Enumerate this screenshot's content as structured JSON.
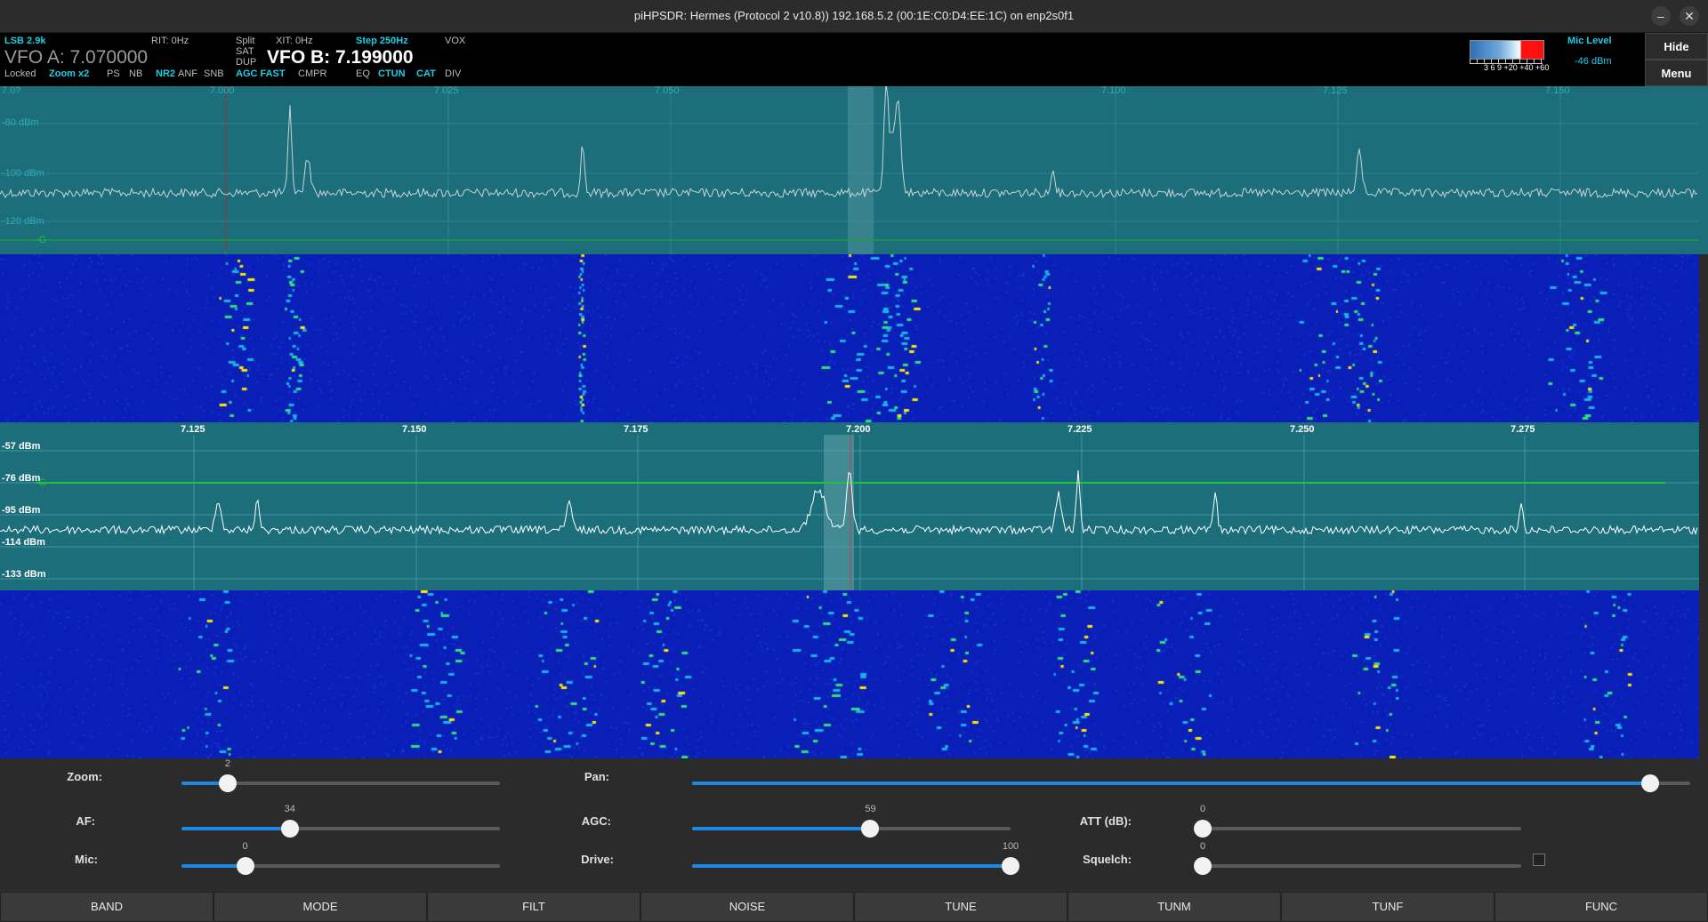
{
  "window": {
    "title": "piHPSDR: Hermes (Protocol 2 v10.8)) 192.168.5.2 (00:1E:C0:D4:EE:1C) on enp2s0f1",
    "minimize": "–",
    "close": "✕"
  },
  "vfo_bar": {
    "mode": "LSB 2.9k",
    "vfo_a": "VFO A: 7.070000",
    "rit": "RIT: 0Hz",
    "split": "Split",
    "sat": "SAT",
    "dup": "DUP",
    "xit": "XIT: 0Hz",
    "step": "Step 250Hz",
    "vox": "VOX",
    "vfo_b": "VFO B: 7.199000",
    "locked": "Locked",
    "zoom": "Zoom x2",
    "ps": "PS",
    "nb": "NB",
    "nr2": "NR2",
    "anf": "ANF",
    "snb": "SNB",
    "agc": "AGC FAST",
    "cmpr": "CMPR",
    "eq": "EQ",
    "ctun": "CTUN",
    "cat": "CAT",
    "div": "DIV",
    "mic_level": "Mic Level",
    "mic_dbm": "-46 dBm",
    "meter_scale": [
      "3",
      "6",
      "9",
      "+20",
      "+40",
      "+60"
    ]
  },
  "side_buttons": {
    "hide": "Hide",
    "menu": "Menu"
  },
  "panadapter_a": {
    "freq_labels": [
      "7.0?",
      "7.000",
      "7.025",
      "7.050",
      "7.100",
      "7.125",
      "7.150"
    ],
    "dbm_labels": [
      "-80 dBm",
      "-100 dBm",
      "-120 dBm"
    ],
    "agc_marker": "-G"
  },
  "panadapter_b": {
    "freq_labels": [
      "7.125",
      "7.150",
      "7.175",
      "7.200",
      "7.225",
      "7.250",
      "7.275"
    ],
    "dbm_labels": [
      "-57 dBm",
      "-76 dBm",
      "-95 dBm",
      "-114 dBm",
      "-133 dBm"
    ],
    "agc_marker": "-G"
  },
  "controls": {
    "zoom": {
      "label": "Zoom:",
      "value": "2",
      "fraction": 0.145
    },
    "pan": {
      "label": "Pan:",
      "fraction": 0.96
    },
    "af": {
      "label": "AF:",
      "value": "34",
      "fraction": 0.34
    },
    "agc": {
      "label": "AGC:",
      "value": "59",
      "fraction": 0.56
    },
    "att": {
      "label": "ATT (dB):",
      "value": "0",
      "fraction": 0.0
    },
    "mic": {
      "label": "Mic:",
      "value": "0",
      "fraction": 0.2
    },
    "drive": {
      "label": "Drive:",
      "value": "100",
      "fraction": 1.0
    },
    "squelch": {
      "label": "Squelch:",
      "value": "0",
      "fraction": 0.0
    }
  },
  "bottom_buttons": [
    "BAND",
    "MODE",
    "FILT",
    "NOISE",
    "TUNE",
    "TUNM",
    "TUNF",
    "FUNC"
  ],
  "colors": {
    "pan_bg": "#1c6e7a",
    "accent": "#1ad0e6",
    "slider": "#1e88e5"
  }
}
